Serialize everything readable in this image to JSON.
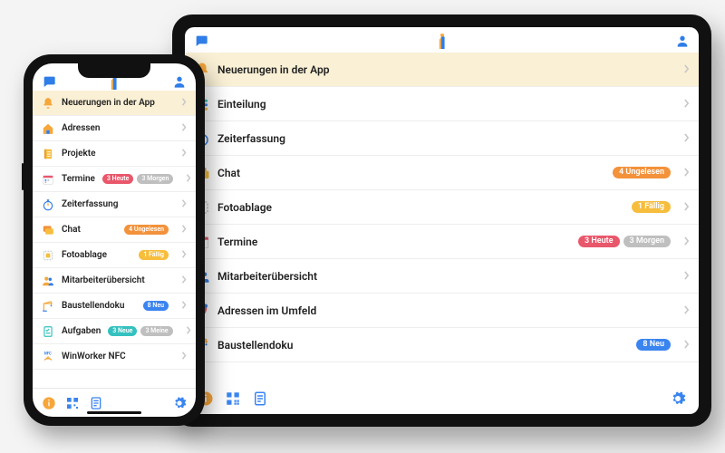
{
  "colors": {
    "red": "#e9576b",
    "gray": "#bfbfbf",
    "orange": "#f3923b",
    "yellow": "#f7bd3c",
    "blue": "#3a84f0",
    "teal": "#34c1bf"
  },
  "phone": {
    "items": [
      {
        "icon": "bell",
        "label": "Neuerungen in der App",
        "highlight": true,
        "badges": []
      },
      {
        "icon": "house",
        "label": "Adressen",
        "badges": []
      },
      {
        "icon": "notebook",
        "label": "Projekte",
        "badges": []
      },
      {
        "icon": "calendar",
        "label": "Termine",
        "badges": [
          {
            "text": "3 Heute",
            "color": "red"
          },
          {
            "text": "3 Morgen",
            "color": "gray"
          }
        ]
      },
      {
        "icon": "stopwatch",
        "label": "Zeiterfassung",
        "badges": []
      },
      {
        "icon": "chat",
        "label": "Chat",
        "badges": [
          {
            "text": "4 Ungelesen",
            "color": "orange"
          }
        ]
      },
      {
        "icon": "frame",
        "label": "Fotoablage",
        "badges": [
          {
            "text": "1 Fällig",
            "color": "yellow"
          }
        ]
      },
      {
        "icon": "people",
        "label": "Mitarbeiterübersicht",
        "badges": []
      },
      {
        "icon": "crane",
        "label": "Baustellendoku",
        "badges": [
          {
            "text": "8 Neu",
            "color": "blue"
          }
        ]
      },
      {
        "icon": "task",
        "label": "Aufgaben",
        "badges": [
          {
            "text": "3 Neue",
            "color": "teal"
          },
          {
            "text": "3 Meine",
            "color": "gray"
          }
        ]
      },
      {
        "icon": "nfc",
        "label": "WinWorker NFC",
        "badges": []
      }
    ]
  },
  "tablet": {
    "items": [
      {
        "icon": "bell",
        "label": "Neuerungen in der App",
        "highlight": true,
        "badges": []
      },
      {
        "icon": "stack",
        "label": "Einteilung",
        "badges": []
      },
      {
        "icon": "stopwatch",
        "label": "Zeiterfassung",
        "badges": []
      },
      {
        "icon": "chat",
        "label": "Chat",
        "badges": [
          {
            "text": "4 Ungelesen",
            "color": "orange"
          }
        ]
      },
      {
        "icon": "frame",
        "label": "Fotoablage",
        "badges": [
          {
            "text": "1 Fällig",
            "color": "yellow"
          }
        ]
      },
      {
        "icon": "calendar",
        "label": "Termine",
        "badges": [
          {
            "text": "3 Heute",
            "color": "red"
          },
          {
            "text": "3 Morgen",
            "color": "gray"
          }
        ]
      },
      {
        "icon": "people",
        "label": "Mitarbeiterübersicht",
        "badges": []
      },
      {
        "icon": "mappin",
        "label": "Adressen im Umfeld",
        "badges": []
      },
      {
        "icon": "crane",
        "label": "Baustellendoku",
        "badges": [
          {
            "text": "8 Neu",
            "color": "blue"
          }
        ]
      }
    ]
  }
}
